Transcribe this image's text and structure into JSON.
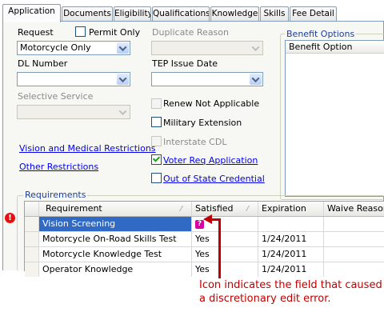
{
  "tabs": [
    {
      "label": "Application",
      "active": true
    },
    {
      "label": "Documents"
    },
    {
      "label": "Eligibility"
    },
    {
      "label": "Qualifications"
    },
    {
      "label": "Knowledge"
    },
    {
      "label": "Skills"
    },
    {
      "label": "Fee Detail"
    }
  ],
  "form": {
    "request_label": "Request",
    "permit_only_label": "Permit Only",
    "request_value": "Motorcycle Only",
    "duplicate_reason_label": "Duplicate Reason",
    "duplicate_reason_value": "",
    "dl_number_label": "DL Number",
    "dl_number_value": "",
    "tep_issue_date_label": "TEP Issue Date",
    "tep_issue_date_value": "",
    "selective_service_label": "Selective Service",
    "selective_service_value": "",
    "renew_not_applicable_label": "Renew Not Applicable",
    "military_extension_label": "Military Extension",
    "interstate_cdl_label": "Interstate CDL",
    "voter_req_label": "Voter Req Application",
    "out_of_state_label": "Out of State Credential",
    "vision_medical_link": "Vision and Medical Restrictions",
    "other_restrictions_link": "Other Restrictions"
  },
  "benefit_options": {
    "legend": "Benefit Options",
    "column_header": "Benefit Option"
  },
  "requirements": {
    "legend": "Requirements",
    "columns": [
      "Requirement",
      "Satisfied",
      "Expiration",
      "Waive Reason"
    ],
    "rows": [
      {
        "requirement": "Vision Screening",
        "satisfied": "",
        "expiration": "",
        "waive_reason": ""
      },
      {
        "requirement": "Motorcycle On-Road Skills Test",
        "satisfied": "Yes",
        "expiration": "1/24/2011",
        "waive_reason": ""
      },
      {
        "requirement": "Motorcycle Knowledge Test",
        "satisfied": "Yes",
        "expiration": "1/24/2011",
        "waive_reason": ""
      },
      {
        "requirement": "Operator Knowledge",
        "satisfied": "Yes",
        "expiration": "1/24/2011",
        "waive_reason": ""
      }
    ],
    "error_icon_glyph": "!",
    "question_icon_glyph": "?"
  },
  "annotation": {
    "caption_line1": "Icon indicates the field that caused",
    "caption_line2": "a discretionary edit error.",
    "color": "#c00000"
  },
  "colors": {
    "selection": "#316ac5",
    "link": "#0000ee",
    "error_icon": "#e31111",
    "question_icon": "#d6009e"
  }
}
